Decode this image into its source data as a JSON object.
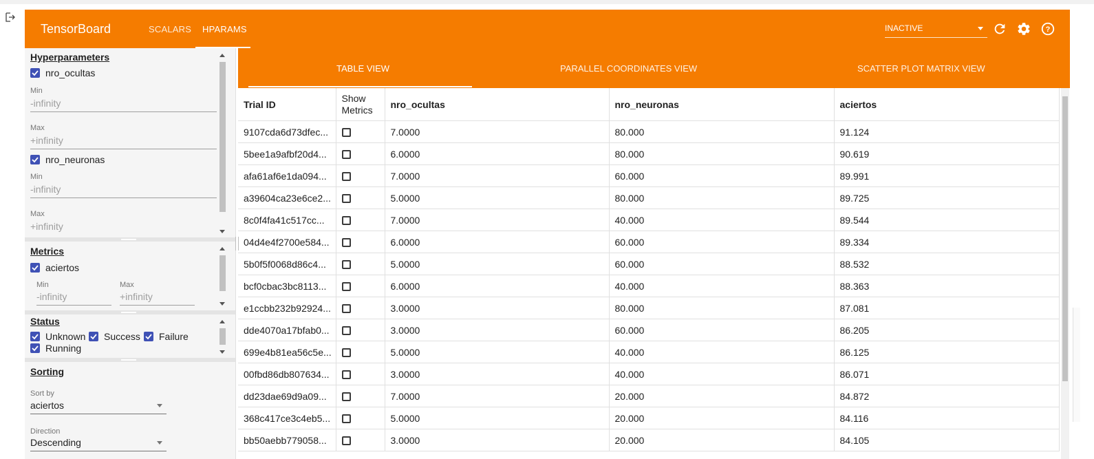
{
  "header": {
    "brand": "TensorBoard",
    "tabs": [
      {
        "label": "SCALARS",
        "active": false
      },
      {
        "label": "HPARAMS",
        "active": true
      }
    ],
    "inactive_select": "INACTIVE",
    "color": "#f57c00"
  },
  "sidebar": {
    "hyperparameters": {
      "title": "Hyperparameters",
      "params": [
        {
          "name": "nro_ocultas",
          "min_label": "Min",
          "min_placeholder": "-infinity",
          "max_label": "Max",
          "max_placeholder": "+infinity"
        },
        {
          "name": "nro_neuronas",
          "min_label": "Min",
          "min_placeholder": "-infinity",
          "max_label": "Max",
          "max_placeholder": "+infinity"
        }
      ]
    },
    "metrics": {
      "title": "Metrics",
      "name": "aciertos",
      "min_label": "Min",
      "min_placeholder": "-infinity",
      "max_label": "Max",
      "max_placeholder": "+infinity"
    },
    "status": {
      "title": "Status",
      "options": [
        "Unknown",
        "Success",
        "Failure",
        "Running"
      ]
    },
    "sorting": {
      "title": "Sorting",
      "sort_by_label": "Sort by",
      "sort_by_value": "aciertos",
      "direction_label": "Direction",
      "direction_value": "Descending"
    }
  },
  "view_tabs": [
    "TABLE VIEW",
    "PARALLEL COORDINATES VIEW",
    "SCATTER PLOT MATRIX VIEW"
  ],
  "table": {
    "headers": [
      "Trial ID",
      "Show Metrics",
      "nro_ocultas",
      "nro_neuronas",
      "aciertos"
    ],
    "rows": [
      [
        "9107cda6d73dfec...",
        "7.0000",
        "80.000",
        "91.124"
      ],
      [
        "5bee1a9afbf20d4...",
        "6.0000",
        "80.000",
        "90.619"
      ],
      [
        "afa61af6e1da094...",
        "7.0000",
        "60.000",
        "89.991"
      ],
      [
        "a39604ca23e6ce2...",
        "5.0000",
        "80.000",
        "89.725"
      ],
      [
        "8c0f4fa41c517cc...",
        "7.0000",
        "40.000",
        "89.544"
      ],
      [
        "04d4e4f2700e584...",
        "6.0000",
        "60.000",
        "89.334"
      ],
      [
        "5b0f5f0068d86c4...",
        "5.0000",
        "60.000",
        "88.532"
      ],
      [
        "bcf0cbac3bc8113...",
        "6.0000",
        "40.000",
        "88.363"
      ],
      [
        "e1ccbb232b92924...",
        "3.0000",
        "80.000",
        "87.081"
      ],
      [
        "dde4070a17bfab0...",
        "3.0000",
        "60.000",
        "86.205"
      ],
      [
        "699e4b81ea56c5e...",
        "5.0000",
        "40.000",
        "86.125"
      ],
      [
        "00fbd86db807634...",
        "3.0000",
        "40.000",
        "86.071"
      ],
      [
        "dd23dae69d9a09...",
        "7.0000",
        "20.000",
        "84.872"
      ],
      [
        "368c417ce3c4eb5...",
        "5.0000",
        "20.000",
        "84.116"
      ],
      [
        "bb50aebb779058...",
        "3.0000",
        "20.000",
        "84.105"
      ]
    ]
  }
}
